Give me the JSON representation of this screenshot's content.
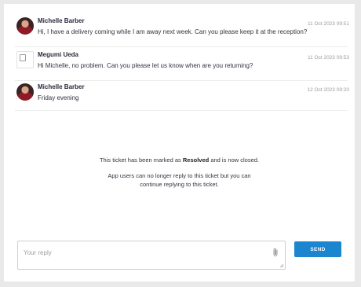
{
  "messages": [
    {
      "sender": "Michelle Barber",
      "text": "Hi, I have a delivery coming while I am away next week. Can you please keep it at the reception?",
      "timestamp": "11 Oct 2023 09:51",
      "avatar": "photo"
    },
    {
      "sender": "Megumi Ueda",
      "text": "Hi Michelle, no problem. Can you please let us know when are you returning?",
      "timestamp": "11 Oct 2023 09:53",
      "avatar": "broken-image"
    },
    {
      "sender": "Michelle Barber",
      "text": "Friday evening",
      "timestamp": "12 Oct 2023 09:20",
      "avatar": "photo"
    }
  ],
  "notice": {
    "line1_prefix": "This ticket has been marked as",
    "status": "Resolved",
    "line1_suffix": "and is now closed.",
    "line2": "App users can no longer reply to this ticket but you can",
    "line3": "continue replying to this ticket."
  },
  "reply": {
    "value": "",
    "placeholder": "Your reply",
    "attach_icon": "paperclip-icon",
    "send_label": "SEND"
  },
  "colors": {
    "background": "#e9e9e9",
    "panel": "#ffffff",
    "accent": "#1b86cf"
  }
}
